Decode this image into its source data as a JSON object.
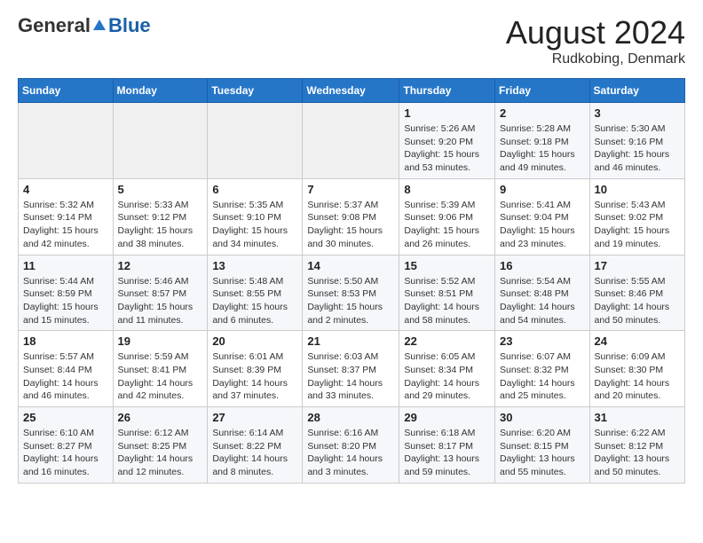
{
  "header": {
    "logo": {
      "part1": "General",
      "part2": "Blue"
    },
    "title": "August 2024",
    "subtitle": "Rudkobing, Denmark"
  },
  "weekdays": [
    "Sunday",
    "Monday",
    "Tuesday",
    "Wednesday",
    "Thursday",
    "Friday",
    "Saturday"
  ],
  "weeks": [
    [
      {
        "day": "",
        "detail": ""
      },
      {
        "day": "",
        "detail": ""
      },
      {
        "day": "",
        "detail": ""
      },
      {
        "day": "",
        "detail": ""
      },
      {
        "day": "1",
        "detail": "Sunrise: 5:26 AM\nSunset: 9:20 PM\nDaylight: 15 hours\nand 53 minutes."
      },
      {
        "day": "2",
        "detail": "Sunrise: 5:28 AM\nSunset: 9:18 PM\nDaylight: 15 hours\nand 49 minutes."
      },
      {
        "day": "3",
        "detail": "Sunrise: 5:30 AM\nSunset: 9:16 PM\nDaylight: 15 hours\nand 46 minutes."
      }
    ],
    [
      {
        "day": "4",
        "detail": "Sunrise: 5:32 AM\nSunset: 9:14 PM\nDaylight: 15 hours\nand 42 minutes."
      },
      {
        "day": "5",
        "detail": "Sunrise: 5:33 AM\nSunset: 9:12 PM\nDaylight: 15 hours\nand 38 minutes."
      },
      {
        "day": "6",
        "detail": "Sunrise: 5:35 AM\nSunset: 9:10 PM\nDaylight: 15 hours\nand 34 minutes."
      },
      {
        "day": "7",
        "detail": "Sunrise: 5:37 AM\nSunset: 9:08 PM\nDaylight: 15 hours\nand 30 minutes."
      },
      {
        "day": "8",
        "detail": "Sunrise: 5:39 AM\nSunset: 9:06 PM\nDaylight: 15 hours\nand 26 minutes."
      },
      {
        "day": "9",
        "detail": "Sunrise: 5:41 AM\nSunset: 9:04 PM\nDaylight: 15 hours\nand 23 minutes."
      },
      {
        "day": "10",
        "detail": "Sunrise: 5:43 AM\nSunset: 9:02 PM\nDaylight: 15 hours\nand 19 minutes."
      }
    ],
    [
      {
        "day": "11",
        "detail": "Sunrise: 5:44 AM\nSunset: 8:59 PM\nDaylight: 15 hours\nand 15 minutes."
      },
      {
        "day": "12",
        "detail": "Sunrise: 5:46 AM\nSunset: 8:57 PM\nDaylight: 15 hours\nand 11 minutes."
      },
      {
        "day": "13",
        "detail": "Sunrise: 5:48 AM\nSunset: 8:55 PM\nDaylight: 15 hours\nand 6 minutes."
      },
      {
        "day": "14",
        "detail": "Sunrise: 5:50 AM\nSunset: 8:53 PM\nDaylight: 15 hours\nand 2 minutes."
      },
      {
        "day": "15",
        "detail": "Sunrise: 5:52 AM\nSunset: 8:51 PM\nDaylight: 14 hours\nand 58 minutes."
      },
      {
        "day": "16",
        "detail": "Sunrise: 5:54 AM\nSunset: 8:48 PM\nDaylight: 14 hours\nand 54 minutes."
      },
      {
        "day": "17",
        "detail": "Sunrise: 5:55 AM\nSunset: 8:46 PM\nDaylight: 14 hours\nand 50 minutes."
      }
    ],
    [
      {
        "day": "18",
        "detail": "Sunrise: 5:57 AM\nSunset: 8:44 PM\nDaylight: 14 hours\nand 46 minutes."
      },
      {
        "day": "19",
        "detail": "Sunrise: 5:59 AM\nSunset: 8:41 PM\nDaylight: 14 hours\nand 42 minutes."
      },
      {
        "day": "20",
        "detail": "Sunrise: 6:01 AM\nSunset: 8:39 PM\nDaylight: 14 hours\nand 37 minutes."
      },
      {
        "day": "21",
        "detail": "Sunrise: 6:03 AM\nSunset: 8:37 PM\nDaylight: 14 hours\nand 33 minutes."
      },
      {
        "day": "22",
        "detail": "Sunrise: 6:05 AM\nSunset: 8:34 PM\nDaylight: 14 hours\nand 29 minutes."
      },
      {
        "day": "23",
        "detail": "Sunrise: 6:07 AM\nSunset: 8:32 PM\nDaylight: 14 hours\nand 25 minutes."
      },
      {
        "day": "24",
        "detail": "Sunrise: 6:09 AM\nSunset: 8:30 PM\nDaylight: 14 hours\nand 20 minutes."
      }
    ],
    [
      {
        "day": "25",
        "detail": "Sunrise: 6:10 AM\nSunset: 8:27 PM\nDaylight: 14 hours\nand 16 minutes."
      },
      {
        "day": "26",
        "detail": "Sunrise: 6:12 AM\nSunset: 8:25 PM\nDaylight: 14 hours\nand 12 minutes."
      },
      {
        "day": "27",
        "detail": "Sunrise: 6:14 AM\nSunset: 8:22 PM\nDaylight: 14 hours\nand 8 minutes."
      },
      {
        "day": "28",
        "detail": "Sunrise: 6:16 AM\nSunset: 8:20 PM\nDaylight: 14 hours\nand 3 minutes."
      },
      {
        "day": "29",
        "detail": "Sunrise: 6:18 AM\nSunset: 8:17 PM\nDaylight: 13 hours\nand 59 minutes."
      },
      {
        "day": "30",
        "detail": "Sunrise: 6:20 AM\nSunset: 8:15 PM\nDaylight: 13 hours\nand 55 minutes."
      },
      {
        "day": "31",
        "detail": "Sunrise: 6:22 AM\nSunset: 8:12 PM\nDaylight: 13 hours\nand 50 minutes."
      }
    ]
  ]
}
